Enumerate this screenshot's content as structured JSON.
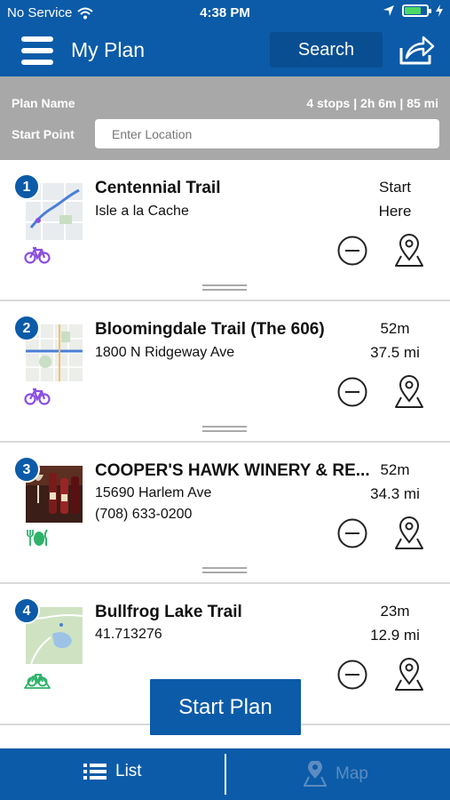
{
  "status_bar": {
    "carrier": "No Service",
    "time": "4:38 PM",
    "battery_level": 0.75
  },
  "header": {
    "title": "My Plan",
    "search_label": "Search",
    "icons": {
      "menu": "hamburger-icon",
      "share": "share-icon"
    }
  },
  "plan": {
    "name_label": "Plan Name",
    "summary": "4 stops | 2h 6m | 85 mi",
    "start_label": "Start Point",
    "start_placeholder": "Enter Location"
  },
  "stops": [
    {
      "number": "1",
      "title": "Centennial Trail",
      "line1": "Isle a la Cache",
      "line2": "",
      "meta_top": "Start",
      "meta_bottom": "Here",
      "category_icon": "bike-icon"
    },
    {
      "number": "2",
      "title": "Bloomingdale Trail (The 606)",
      "line1": "1800 N Ridgeway Ave",
      "line2": "",
      "meta_top": "52m",
      "meta_bottom": "37.5 mi",
      "category_icon": "bike-icon"
    },
    {
      "number": "3",
      "title": "COOPER'S HAWK WINERY & RE...",
      "line1": "15690 Harlem Ave",
      "line2": "(708) 633-0200",
      "meta_top": "52m",
      "meta_bottom": "34.3 mi",
      "category_icon": "dining-icon"
    },
    {
      "number": "4",
      "title": "Bullfrog Lake Trail",
      "line1": "41.713276",
      "line2": "",
      "meta_top": "23m",
      "meta_bottom": "12.9 mi",
      "category_icon": "mountain-bike-icon"
    }
  ],
  "start_plan_label": "Start Plan",
  "tabs": {
    "list_label": "List",
    "map_label": "Map"
  },
  "colors": {
    "brand_blue": "#0b5ba8",
    "info_gray": "#a8a8a8",
    "bike_purple": "#8a4fe0",
    "category_green": "#2fb36b",
    "map_tab_inactive": "#5c8cc0"
  }
}
